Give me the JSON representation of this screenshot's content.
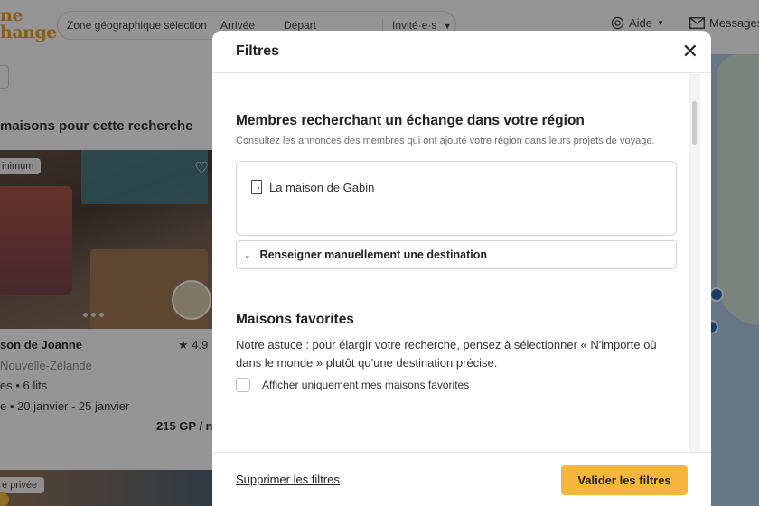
{
  "header": {
    "logo_line1": "ne",
    "logo_line2": "hange",
    "search": {
      "zone": "Zone géographique sélection",
      "arrival": "Arrivée",
      "departure": "Départ",
      "guests": "Invité·e·s"
    },
    "help_label": "Aide",
    "messages_label": "Messages"
  },
  "results": {
    "title": "maisons pour cette recherche",
    "card1": {
      "badge": "inimum",
      "name": "son de Joanne",
      "rating": "4.9",
      "location": "Nouvelle-Zélande",
      "beds": "es • 6 lits",
      "dates": "e • 20 janvier - 25 janvier",
      "price": "215 GP / n"
    },
    "card2": {
      "badge": "e privée"
    }
  },
  "modal": {
    "title": "Filtres",
    "section_members": {
      "title": "Membres recherchant un échange dans votre région",
      "description": "Consultez les annonces des membres qui ont ajouté votre région dans leurs projets de voyage.",
      "member_name": "La maison de Gabin",
      "manual_destination": "Renseigner manuellement une destination"
    },
    "section_favorites": {
      "title": "Maisons favorites",
      "description": "Notre astuce : pour élargir votre recherche, pensez à sélectionner « N'importe où dans le monde » plutôt qu'une destination précise.",
      "checkbox_label": "Afficher uniquement mes maisons favorites"
    },
    "footer": {
      "clear_label": "Supprimer les filtres",
      "apply_label": "Valider les filtres"
    }
  },
  "colors": {
    "accent": "#f5b63b",
    "brand": "#e79a2a",
    "map_pin": "#1f5fb0"
  }
}
